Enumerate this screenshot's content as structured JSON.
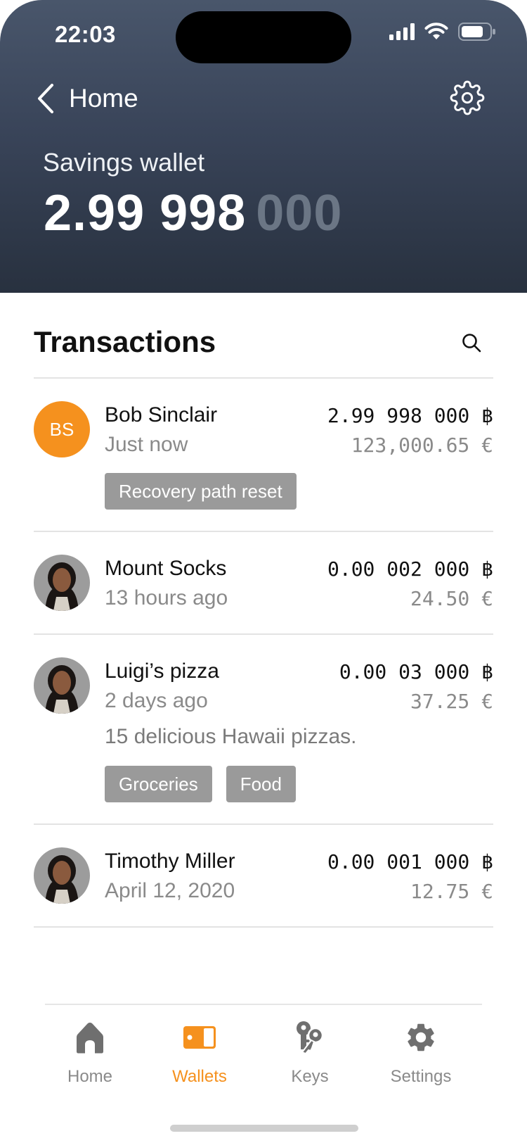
{
  "status_bar": {
    "time": "22:03"
  },
  "nav": {
    "back_label": "Home"
  },
  "wallet": {
    "name": "Savings wallet",
    "balance_main": "2.99 998",
    "balance_dim": "000"
  },
  "transactions": {
    "title": "Transactions",
    "items": [
      {
        "name": "Bob Sinclair",
        "initials": "BS",
        "time": "Just now",
        "btc": "2.99 998 000 ฿",
        "eur": "123,000.65 €",
        "note": "",
        "tags": [
          "Recovery path reset"
        ]
      },
      {
        "name": "Mount Socks",
        "time": "13 hours ago",
        "btc": "0.00 002 000 ฿",
        "eur": "24.50 €",
        "note": "",
        "tags": []
      },
      {
        "name": "Luigi’s pizza",
        "time": "2 days ago",
        "btc": "0.00 03 000 ฿",
        "eur": "37.25 €",
        "note": "15 delicious Hawaii pizzas.",
        "tags": [
          "Groceries",
          "Food"
        ]
      },
      {
        "name": "Timothy Miller",
        "time": "April 12, 2020",
        "btc": "0.00 001 000 ฿",
        "eur": "12.75 €",
        "note": "",
        "tags": []
      }
    ]
  },
  "tabbar": {
    "items": [
      {
        "label": "Home",
        "icon": "home-icon",
        "active": false
      },
      {
        "label": "Wallets",
        "icon": "wallet-icon",
        "active": true
      },
      {
        "label": "Keys",
        "icon": "keys-icon",
        "active": false
      },
      {
        "label": "Settings",
        "icon": "gear-icon",
        "active": false
      }
    ]
  },
  "colors": {
    "accent": "#f5911e",
    "header_top": "#49566b",
    "header_bottom": "#28313f",
    "tag_bg": "#9a9a9a",
    "muted_text": "#8a8a8a"
  }
}
